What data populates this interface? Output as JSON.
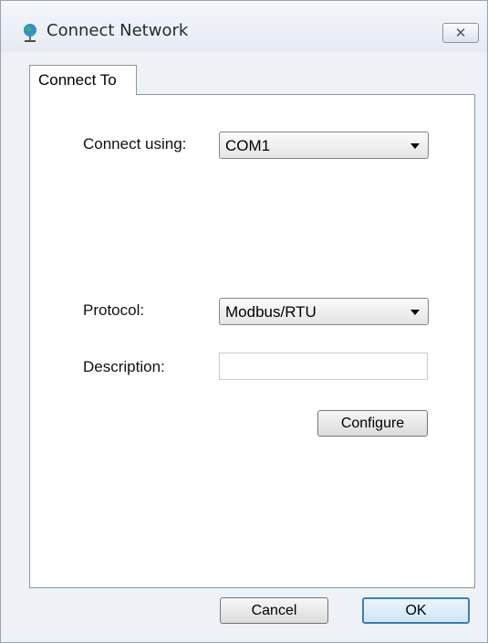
{
  "window": {
    "title": "Connect Network",
    "icon": "network-globe-icon",
    "close_icon": "close-icon"
  },
  "tabs": [
    {
      "label": "Connect To",
      "active": true
    }
  ],
  "form": {
    "connect_using": {
      "label": "Connect using:",
      "value": "COM1"
    },
    "protocol": {
      "label": "Protocol:",
      "value": "Modbus/RTU"
    },
    "description": {
      "label": "Description:",
      "value": ""
    },
    "configure_label": "Configure"
  },
  "footer": {
    "cancel_label": "Cancel",
    "ok_label": "OK"
  },
  "colors": {
    "default_button_border": "#3c7fb1",
    "window_bg": "#eef1f6"
  }
}
